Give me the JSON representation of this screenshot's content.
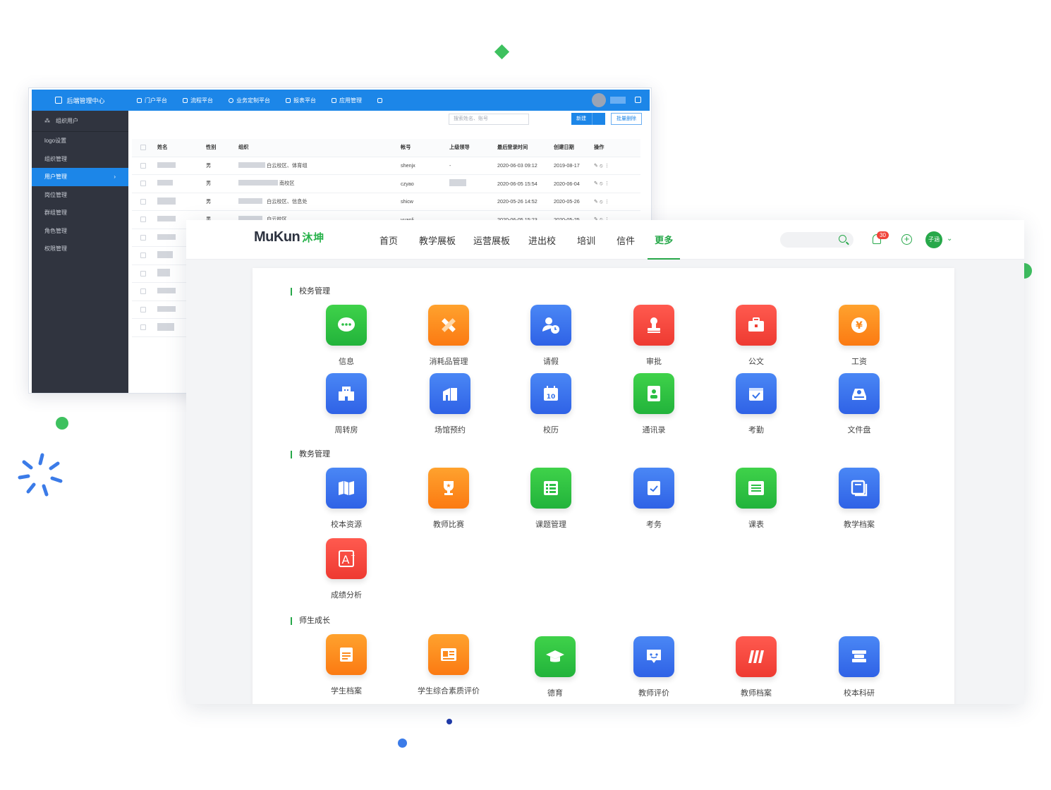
{
  "admin": {
    "brand": "后端管理中心",
    "section": "组织用户",
    "menu": [
      "logo设置",
      "组织管理",
      "用户管理",
      "岗位管理",
      "群组管理",
      "角色管理",
      "权限管理"
    ],
    "top_nav": [
      "门户平台",
      "流程平台",
      "业务定制平台",
      "报表平台",
      "应用管理"
    ],
    "search_placeholder": "搜索姓名、账号",
    "new_label": "新建",
    "batch_delete_label": "批量删除",
    "columns": [
      "姓名",
      "性别",
      "组织",
      "帐号",
      "上级领导",
      "最后登录时间",
      "创建日期",
      "操作"
    ],
    "rows": [
      {
        "gender": "男",
        "org": "白云校区、体育组",
        "account": "shenjx",
        "leader": "-",
        "last_login": "2020-06-03 09:12",
        "created": "2019-08-17"
      },
      {
        "gender": "男",
        "org": "南校区",
        "account": "czyao",
        "leader": "",
        "last_login": "2020-06-05 15:54",
        "created": "2020-06-04"
      },
      {
        "gender": "男",
        "org": "白云校区、信息处",
        "account": "shicw",
        "leader": "",
        "last_login": "2020-05-26 14:52",
        "created": "2020-05-26"
      },
      {
        "gender": "男",
        "org": "白云校区",
        "account": "yuanli",
        "leader": "",
        "last_login": "2020-06-05 15:23",
        "created": "2020-05-25"
      }
    ]
  },
  "app": {
    "logo_text": "MuKun",
    "logo_cn": "沐坤",
    "nav": [
      "首页",
      "教学展板",
      "运营展板",
      "进出校",
      "培训",
      "信件",
      "更多"
    ],
    "active_nav": "更多",
    "notify_count": "30",
    "user_name": "子涵",
    "sections": [
      {
        "title": "校务管理",
        "tiles": [
          {
            "label": "信息",
            "color": "green",
            "icon": "chat-icon"
          },
          {
            "label": "消耗品管理",
            "color": "orange",
            "icon": "pencil-ruler-icon"
          },
          {
            "label": "请假",
            "color": "blue",
            "icon": "user-clock-icon"
          },
          {
            "label": "审批",
            "color": "red",
            "icon": "stamp-icon"
          },
          {
            "label": "公文",
            "color": "red",
            "icon": "briefcase-icon"
          },
          {
            "label": "工资",
            "color": "orange",
            "icon": "yen-icon"
          },
          {
            "label": "周转房",
            "color": "blue",
            "icon": "building-icon"
          },
          {
            "label": "场馆预约",
            "color": "blue",
            "icon": "venue-icon"
          },
          {
            "label": "校历",
            "color": "blue",
            "icon": "calendar-icon"
          },
          {
            "label": "通讯录",
            "color": "green",
            "icon": "contacts-icon"
          },
          {
            "label": "考勤",
            "color": "blue",
            "icon": "calendar-check-icon"
          },
          {
            "label": "文件盘",
            "color": "blue",
            "icon": "cloud-drive-icon"
          }
        ]
      },
      {
        "title": "教务管理",
        "tiles": [
          {
            "label": "校本资源",
            "color": "blue",
            "icon": "book-icon"
          },
          {
            "label": "教师比赛",
            "color": "orange",
            "icon": "trophy-icon"
          },
          {
            "label": "课题管理",
            "color": "green",
            "icon": "list-icon"
          },
          {
            "label": "考务",
            "color": "blue",
            "icon": "exam-icon"
          },
          {
            "label": "课表",
            "color": "green",
            "icon": "timetable-icon"
          },
          {
            "label": "教学档案",
            "color": "blue",
            "icon": "archive-icon"
          },
          {
            "label": "成绩分析",
            "color": "red",
            "icon": "grade-icon"
          }
        ]
      },
      {
        "title": "师生成长",
        "tiles": [
          {
            "label": "学生档案",
            "color": "orange",
            "icon": "folder-icon"
          },
          {
            "label": "学生综合素质评价",
            "color": "orange",
            "icon": "id-card-icon"
          },
          {
            "label": "德育",
            "color": "green",
            "icon": "graduation-cap-icon"
          },
          {
            "label": "教师评价",
            "color": "blue",
            "icon": "comment-icon"
          },
          {
            "label": "教师档案",
            "color": "red",
            "icon": "binders-icon"
          },
          {
            "label": "校本科研",
            "color": "blue",
            "icon": "research-icon"
          }
        ]
      }
    ]
  }
}
